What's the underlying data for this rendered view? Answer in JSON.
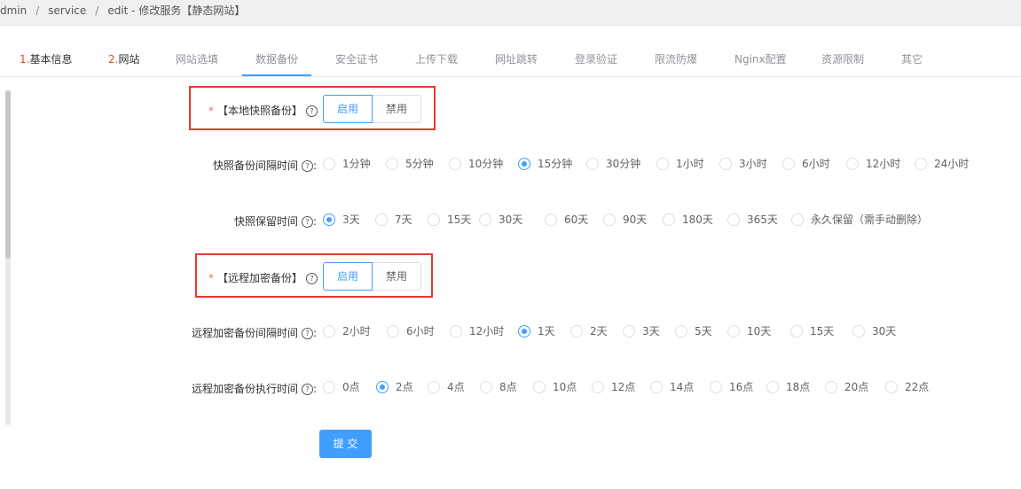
{
  "breadcrumb": [
    "dmin",
    "service",
    "edit - 修改服务【静态网站】"
  ],
  "tabs": [
    {
      "num": "1.",
      "label": "基本信息"
    },
    {
      "num": "2.",
      "label": "网站"
    },
    {
      "num": "",
      "label": "网站选填"
    },
    {
      "num": "",
      "label": "数据备份"
    },
    {
      "num": "",
      "label": "安全证书"
    },
    {
      "num": "",
      "label": "上传下载"
    },
    {
      "num": "",
      "label": "网址跳转"
    },
    {
      "num": "",
      "label": "登录验证"
    },
    {
      "num": "",
      "label": "限流防爆"
    },
    {
      "num": "",
      "label": "Nginx配置"
    },
    {
      "num": "",
      "label": "资源限制"
    },
    {
      "num": "",
      "label": "其它"
    }
  ],
  "active_tab": "数据备份",
  "local_backup": {
    "label": "【本地快照备份】",
    "enable": "启用",
    "disable": "禁用",
    "interval_label": "快照备份间隔时间",
    "interval_options": [
      "1分钟",
      "5分钟",
      "10分钟",
      "15分钟",
      "30分钟",
      "1小时",
      "3小时",
      "6小时",
      "12小时",
      "24小时"
    ],
    "interval_selected": "15分钟",
    "retention_label": "快照保留时间",
    "retention_options": [
      "3天",
      "7天",
      "15天",
      "30天",
      "60天",
      "90天",
      "180天",
      "365天",
      "永久保留（需手动删除）"
    ],
    "retention_selected": "3天"
  },
  "remote_backup": {
    "label": "【远程加密备份】",
    "enable": "启用",
    "disable": "禁用",
    "interval_label": "远程加密备份间隔时间",
    "interval_options": [
      "2小时",
      "6小时",
      "12小时",
      "1天",
      "2天",
      "3天",
      "5天",
      "10天",
      "15天",
      "30天"
    ],
    "interval_selected": "1天",
    "exec_label": "远程加密备份执行时间",
    "exec_options": [
      "0点",
      "2点",
      "4点",
      "8点",
      "10点",
      "12点",
      "14点",
      "16点",
      "18点",
      "20点",
      "22点"
    ],
    "exec_selected": "2点"
  },
  "submit_label": "提 交",
  "accent_color": "#409eff",
  "highlight_color": "#e53935"
}
